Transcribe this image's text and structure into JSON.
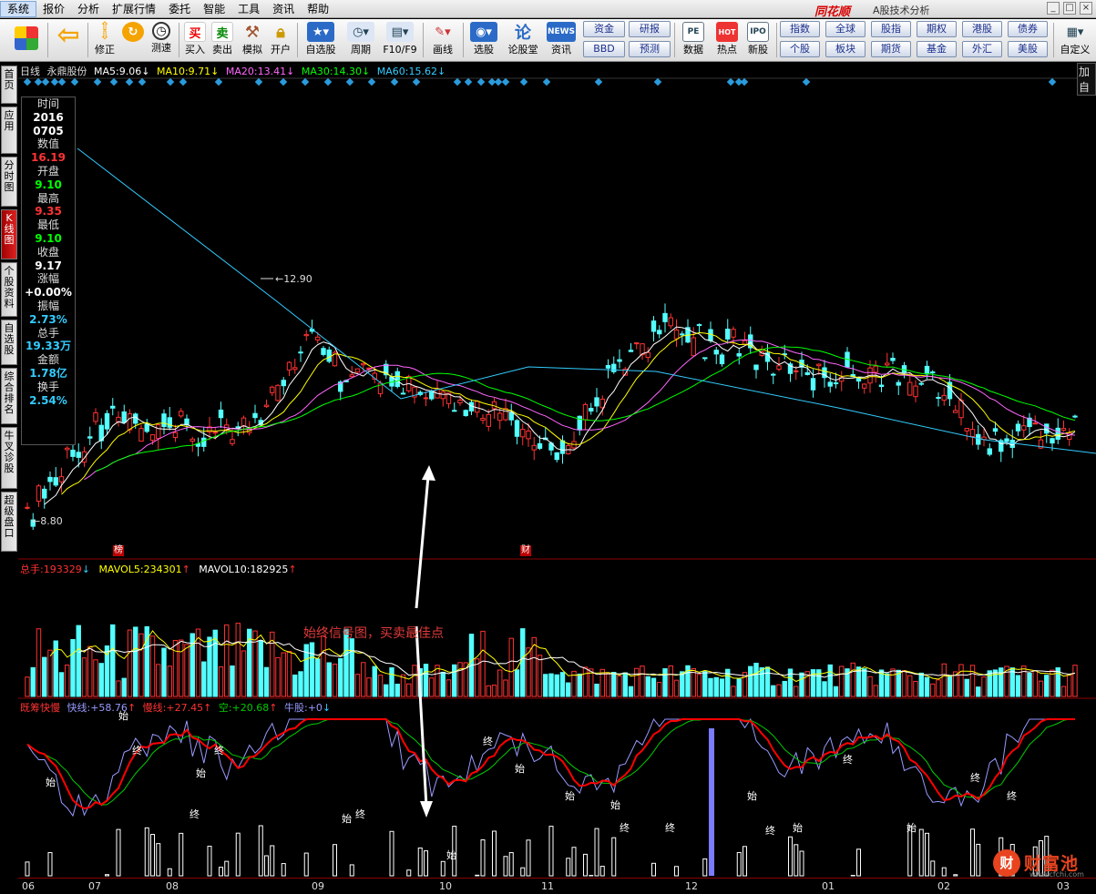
{
  "menu": [
    "系统",
    "报价",
    "分析",
    "扩展行情",
    "委托",
    "智能",
    "工具",
    "资讯",
    "帮助"
  ],
  "brand": {
    "name": "同花顺",
    "subtitle": "A股技术分析"
  },
  "toolbar": {
    "buttons": [
      "修正",
      "测速",
      "买入",
      "卖出",
      "模拟",
      "开户",
      "自选股",
      "周期",
      "F10/F9",
      "画线",
      "选股",
      "论股堂",
      "资讯",
      "数据",
      "热点",
      "新股",
      "自定义"
    ],
    "buy_icon": "买",
    "sell_icon": "卖",
    "news_icon": "NEWS",
    "discuss_icon": "论",
    "hot_icon": "HOT",
    "quick": [
      "资金",
      "研报",
      "BBD",
      "预测",
      "指数",
      "全球",
      "股指",
      "期权",
      "港股",
      "债券",
      "个股",
      "板块",
      "期货",
      "基金",
      "外汇",
      "美股"
    ]
  },
  "sidebar": [
    "首页",
    "应用",
    "分时图",
    "K线图",
    "个股资料",
    "自选股",
    "综合排名",
    "牛叉诊股",
    "超级盘口"
  ],
  "chart_header": {
    "period": "日线",
    "stock": "永鼎股份",
    "ma": [
      {
        "label": "MA5:",
        "value": "9.06",
        "color": "#ffffff"
      },
      {
        "label": "MA10:",
        "value": "9.71",
        "color": "#ffff00"
      },
      {
        "label": "MA20:",
        "value": "13.41",
        "color": "#ff66ff"
      },
      {
        "label": "MA30:",
        "value": "14.30",
        "color": "#00ff00"
      },
      {
        "label": "MA60:",
        "value": "15.62",
        "color": "#33ccff"
      }
    ],
    "add_label": "加自"
  },
  "infobox": [
    {
      "k": "时间",
      "v": "2016",
      "c": "#ffffff"
    },
    {
      "k": "",
      "v": "0705",
      "c": "#ffffff"
    },
    {
      "k": "数值",
      "v": "16.19",
      "c": "#ff3333"
    },
    {
      "k": "开盘",
      "v": "9.10",
      "c": "#00ff00"
    },
    {
      "k": "最高",
      "v": "9.35",
      "c": "#ff3333"
    },
    {
      "k": "最低",
      "v": "9.10",
      "c": "#00ff00"
    },
    {
      "k": "收盘",
      "v": "9.17",
      "c": "#ffffff"
    },
    {
      "k": "涨幅",
      "v": "+0.00%",
      "c": "#ffffff"
    },
    {
      "k": "振幅",
      "v": "2.73%",
      "c": "#33ccff"
    },
    {
      "k": "总手",
      "v": "19.33万",
      "c": "#33ccff"
    },
    {
      "k": "金额",
      "v": "1.78亿",
      "c": "#33ccff"
    },
    {
      "k": "换手",
      "v": "2.54%",
      "c": "#33ccff"
    }
  ],
  "price_marks": {
    "high": "12.90",
    "low": "8.80"
  },
  "event_tags": [
    "榜",
    "财"
  ],
  "volume": {
    "total_label": "总手:",
    "total_value": "193329",
    "mavol5_label": "MAVOL5:",
    "mavol5_value": "234301",
    "mavol10_label": "MAVOL10:",
    "mavol10_value": "182925"
  },
  "indicator": {
    "name": "既筹快慢",
    "fast_label": "快线:",
    "fast_value": "+58.76",
    "slow_label": "慢线:",
    "slow_value": "+27.45",
    "empty_label": "空:",
    "empty_value": "+20.68",
    "bull_label": "牛股:",
    "bull_value": "+0",
    "start_mark": "始",
    "end_mark": "终"
  },
  "annotation": "始终信号图，买卖最佳点",
  "x_axis": [
    "06",
    "07",
    "08",
    "09",
    "10",
    "11",
    "12",
    "01",
    "02",
    "03"
  ],
  "logo": {
    "mark": "财",
    "name": "财富池",
    "url": "www.cfchi.com"
  },
  "colors": {
    "up": "#ff3232",
    "down": "#54ffff",
    "ma5": "#ffffff",
    "ma10": "#ffff00",
    "ma20": "#ff66ff",
    "ma30": "#00ff00",
    "ma60": "#33ccff",
    "fast": "#9999ff",
    "slow": "#ff0000",
    "empty": "#00cc00"
  },
  "chart_data": {
    "type": "candlestick",
    "period": "daily",
    "price_range": [
      8.8,
      12.9
    ],
    "known_bars": [
      {
        "date": "20160705",
        "open": 9.1,
        "high": 9.35,
        "low": 9.1,
        "close": 9.17
      }
    ],
    "annotated_high": 12.9,
    "annotated_low": 8.8
  }
}
